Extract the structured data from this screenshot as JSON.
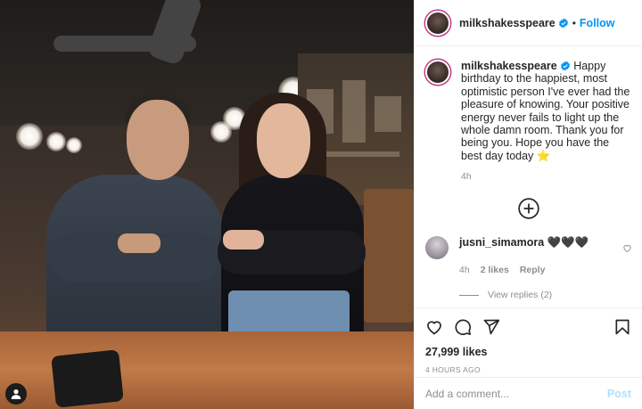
{
  "header": {
    "username": "milkshakesspeare",
    "separator": "•",
    "follow_label": "Follow"
  },
  "caption": {
    "username": "milkshakesspeare",
    "text": "Happy birthday to the happiest, most optimistic person I've ever had the pleasure of knowing. Your positive energy never fails to light up the whole damn room. Thank you for being you. Hope you have the best day today",
    "emoji": "⭐",
    "age": "4h"
  },
  "comment": {
    "username": "jusni_simamora",
    "text": "🖤🖤🖤",
    "age": "4h",
    "likes": "2 likes",
    "reply_label": "Reply",
    "view_replies": "View replies (2)"
  },
  "actions": {
    "likes_count": "27,999 likes",
    "posted": "4 HOURS AGO"
  },
  "add_comment": {
    "placeholder": "Add a comment...",
    "post_label": "Post"
  },
  "colors": {
    "accent": "#0095f6",
    "post_disabled": "#b2dffc",
    "muted": "#8e8e8e",
    "text": "#262626"
  },
  "icons": [
    "verified-badge-icon",
    "plus-circle-icon",
    "heart-icon",
    "comment-icon",
    "share-icon",
    "bookmark-icon",
    "user-tag-icon"
  ]
}
